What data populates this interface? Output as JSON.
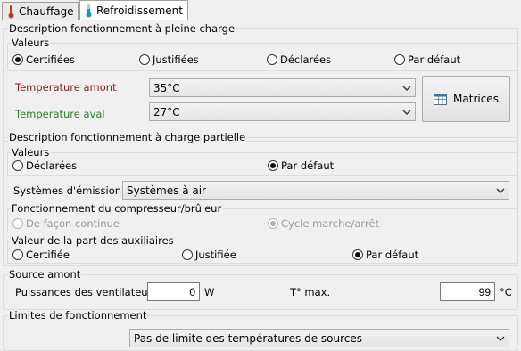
{
  "tabs": [
    {
      "label": "Chauffage",
      "icon": "thermometer-hot-icon",
      "color": "#c0392b"
    },
    {
      "label": "Refroidissement",
      "icon": "thermometer-cold-icon",
      "color": "#1e90c8",
      "active": true
    }
  ],
  "full_load": {
    "title": "Description fonctionnement à pleine charge",
    "values_title": "Valeurs",
    "radios": [
      "Certifiées",
      "Justifiées",
      "Déclarées",
      "Par défaut"
    ],
    "selected": "Certifiées",
    "temp_amont_label": "Temperature amont",
    "temp_amont_color": "#8b1a1a",
    "temp_amont_value": "35°C",
    "temp_aval_label": "Temperature aval",
    "temp_aval_color": "#2e7d2e",
    "temp_aval_value": "27°C",
    "matrices_label": "Matrices"
  },
  "partial_load": {
    "title": "Description fonctionnement à charge partielle",
    "values_title": "Valeurs",
    "radios": [
      "Déclarées",
      "Par défaut"
    ],
    "selected": "Par défaut",
    "emission_label": "Systèmes d'émission",
    "emission_value": "Systèmes à air",
    "compressor_title": "Fonctionnement du compresseur/brûleur",
    "compressor_radios": [
      "De façon continue",
      "Cycle marche/arrêt"
    ],
    "compressor_selected": "Cycle marche/arrêt",
    "aux_title": "Valeur de la part des auxiliaires",
    "aux_radios": [
      "Certifiée",
      "Justifiée",
      "Par défaut"
    ],
    "aux_selected": "Par défaut"
  },
  "source": {
    "title": "Source amont",
    "fans_label": "Puissances des ventilateurs",
    "fans_value": "0",
    "fans_unit": "W",
    "tmax_label": "T° max.",
    "tmax_value": "99",
    "tmax_unit": "°C"
  },
  "limits": {
    "title": "Limites de fonctionnement",
    "value": "Pas de limite des températures de sources"
  }
}
